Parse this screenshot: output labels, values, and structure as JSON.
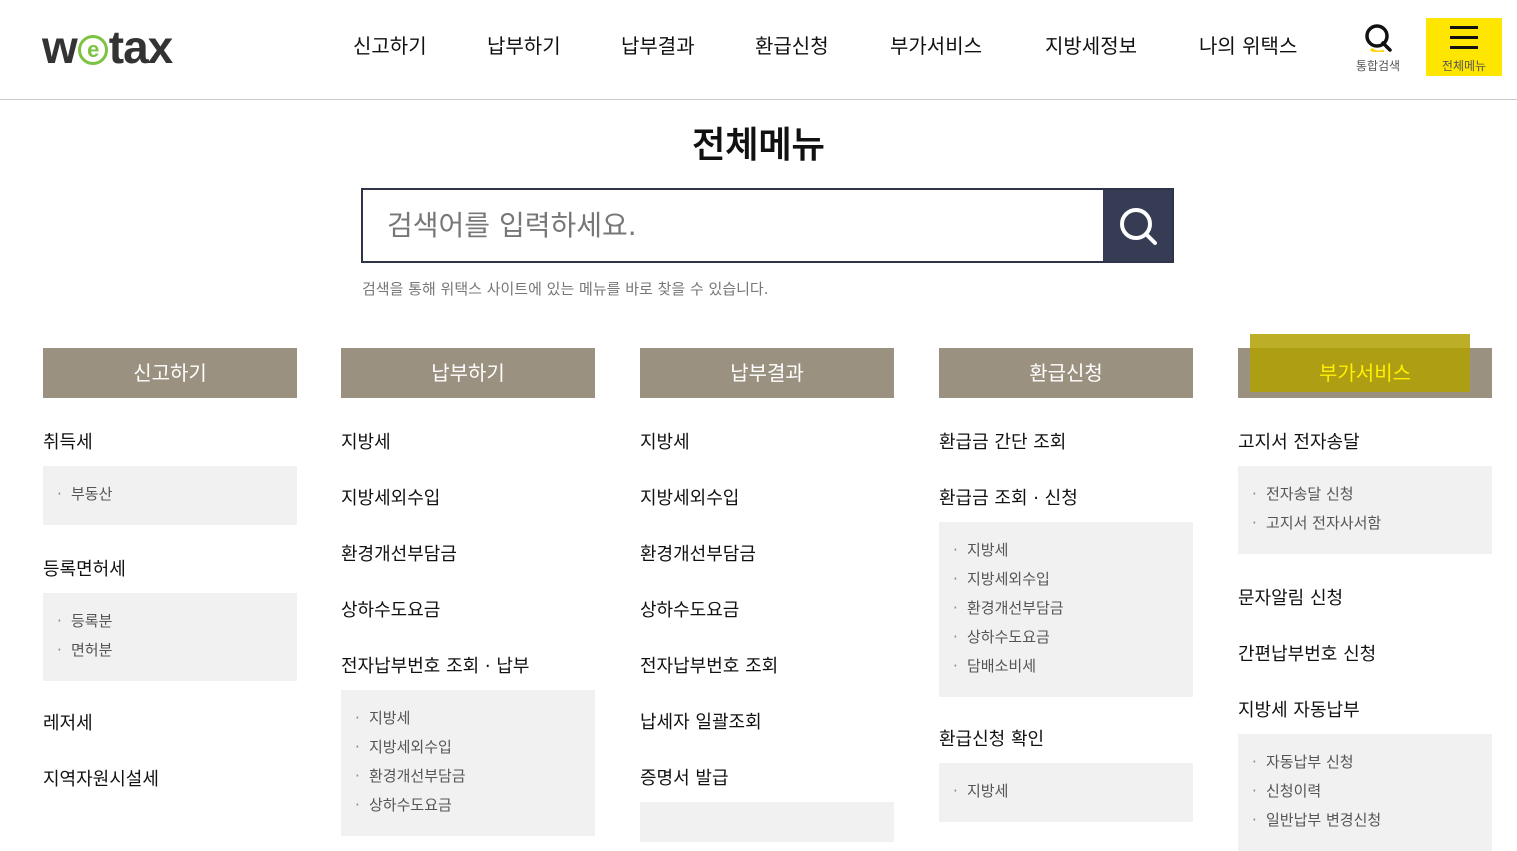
{
  "header": {
    "logo": {
      "w": "w",
      "e": "e",
      "rest": "tax"
    },
    "nav": [
      "신고하기",
      "납부하기",
      "납부결과",
      "환급신청",
      "부가서비스",
      "지방세정보",
      "나의 위택스"
    ],
    "search_label": "통합검색",
    "menu_label": "전체메뉴"
  },
  "title": "전체메뉴",
  "search": {
    "placeholder": "검색어를 입력하세요.",
    "help": "검색을 통해 위택스 사이트에 있는 메뉴를 바로 찾을 수 있습니다."
  },
  "columns": [
    {
      "head": "신고하기",
      "sections": [
        {
          "label": "취득세",
          "items": [
            "부동산"
          ]
        },
        {
          "label": "등록면허세",
          "items": [
            "등록분",
            "면허분"
          ]
        },
        {
          "label": "레저세",
          "items": []
        },
        {
          "label": "지역자원시설세",
          "items": []
        }
      ]
    },
    {
      "head": "납부하기",
      "sections": [
        {
          "label": "지방세",
          "items": []
        },
        {
          "label": "지방세외수입",
          "items": []
        },
        {
          "label": "환경개선부담금",
          "items": []
        },
        {
          "label": "상하수도요금",
          "items": []
        },
        {
          "label": "전자납부번호 조회 · 납부",
          "items": [
            "지방세",
            "지방세외수입",
            "환경개선부담금",
            "상하수도요금"
          ]
        }
      ]
    },
    {
      "head": "납부결과",
      "sections": [
        {
          "label": "지방세",
          "items": []
        },
        {
          "label": "지방세외수입",
          "items": []
        },
        {
          "label": "환경개선부담금",
          "items": []
        },
        {
          "label": "상하수도요금",
          "items": []
        },
        {
          "label": "전자납부번호 조회",
          "items": []
        },
        {
          "label": "납세자 일괄조회",
          "items": []
        },
        {
          "label": "증명서 발급",
          "items": [
            ""
          ]
        }
      ]
    },
    {
      "head": "환급신청",
      "sections": [
        {
          "label": "환급금 간단 조회",
          "items": []
        },
        {
          "label": "환급금 조회 · 신청",
          "items": [
            "지방세",
            "지방세외수입",
            "환경개선부담금",
            "상하수도요금",
            "담배소비세"
          ]
        },
        {
          "label": "환급신청 확인",
          "items": [
            "지방세"
          ]
        }
      ]
    },
    {
      "head": "부가서비스",
      "sections": [
        {
          "label": "고지서 전자송달",
          "items": [
            "전자송달 신청",
            "고지서 전자사서함"
          ]
        },
        {
          "label": "문자알림 신청",
          "items": []
        },
        {
          "label": "간편납부번호 신청",
          "items": []
        },
        {
          "label": "지방세 자동납부",
          "items": [
            "자동납부 신청",
            "신청이력",
            "일반납부 변경신청"
          ]
        }
      ]
    }
  ]
}
